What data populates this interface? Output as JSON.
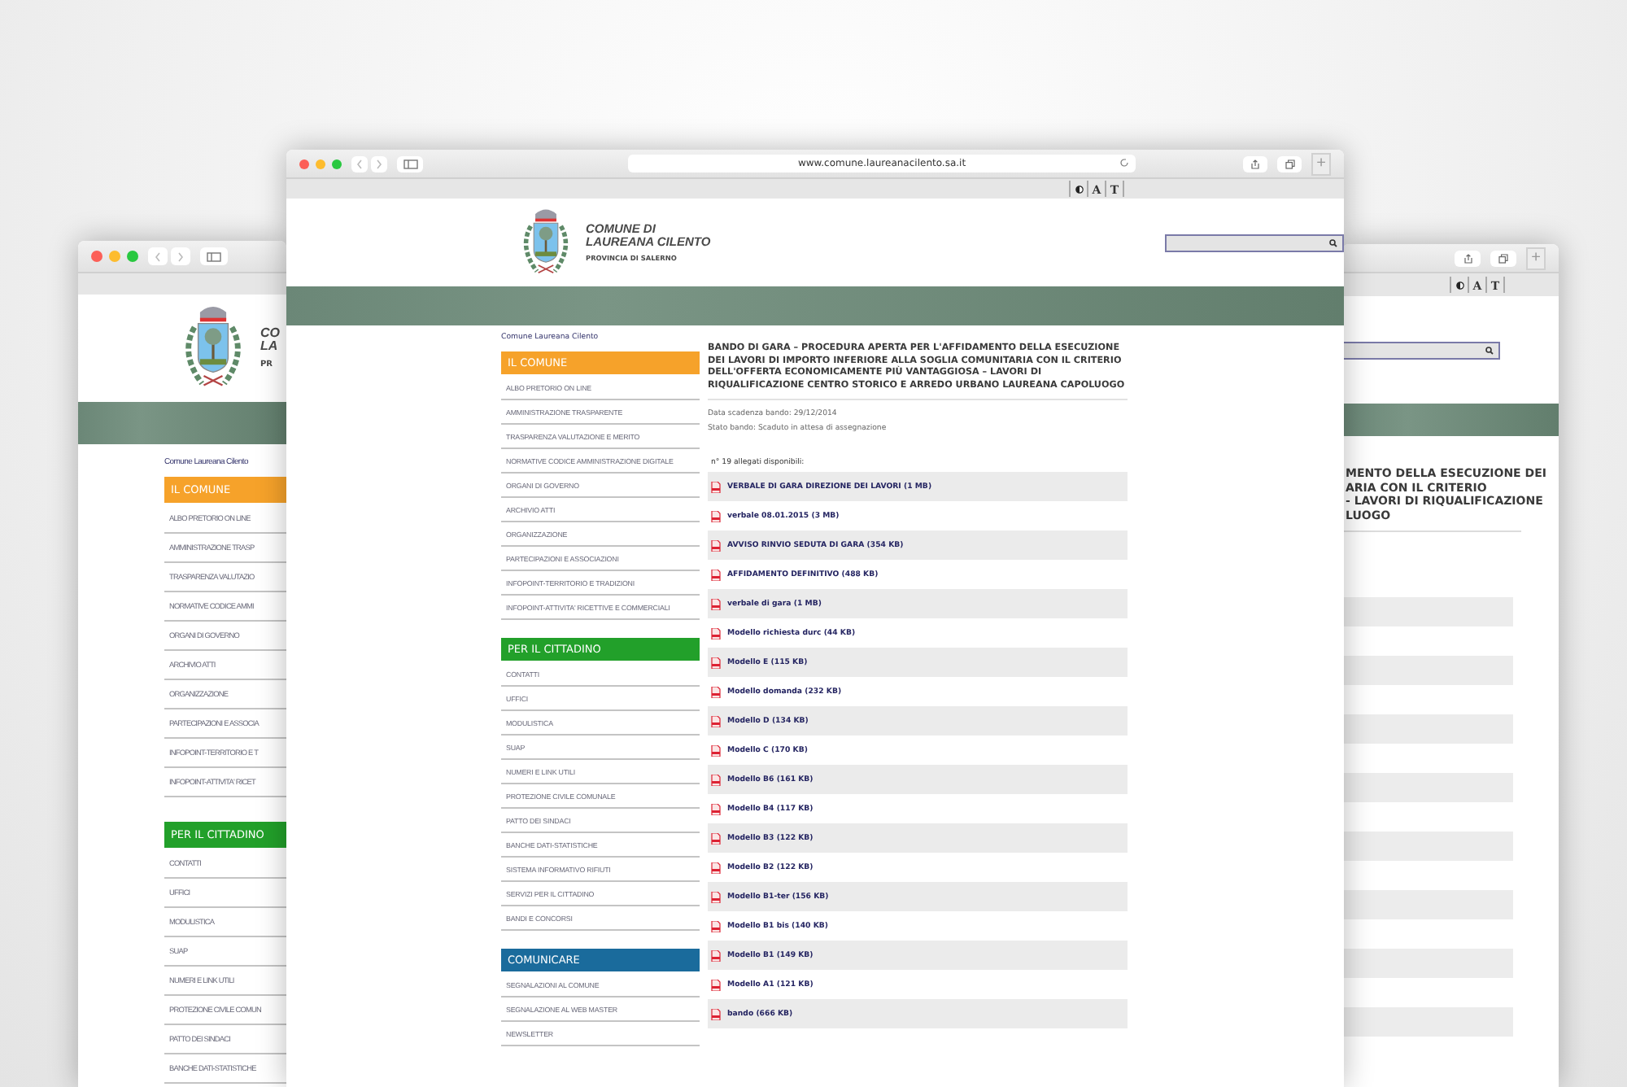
{
  "left_window": {
    "logo_text": [
      "CO",
      "LA",
      "PR"
    ],
    "breadcrumb": "Comune Laureana Cilento",
    "sections": [
      {
        "title": "IL COMUNE",
        "color": "#f6a22a",
        "items": [
          "ALBO PRETORIO ON LINE",
          "AMMINISTRAZIONE TRASP",
          "TRASPARENZA VALUTAZIO",
          "NORMATIVE CODICE AMMI",
          "ORGANI DI GOVERNO",
          "ARCHIVIO ATTI",
          "ORGANIZZAZIONE",
          "PARTECIPAZIONI E ASSOCIA",
          "INFOPOINT-TERRITORIO E T",
          "INFOPOINT-ATTIVITA' RICET"
        ]
      },
      {
        "title": "PER IL CITTADINO",
        "color": "#22a02a",
        "items": [
          "CONTATTI",
          "UFFICI",
          "MODULISTICA",
          "SUAP",
          "NUMERI E LINK UTILI",
          "PROTEZIONE CIVILE COMUN",
          "PATTO DEI SINDACI",
          "BANCHE DATI-STATISTICHE"
        ]
      }
    ]
  },
  "right_window": {
    "new_tab_label": "+",
    "font_buttons": [
      "A",
      "T"
    ],
    "title_lines": [
      "MENTO DELLA ESECUZIONE DEI",
      "ARIA CON IL CRITERIO",
      "- LAVORI DI RIQUALIFICAZIONE",
      "LUOGO"
    ]
  },
  "front_window": {
    "url": "www.comune.laureanacilento.sa.it",
    "new_tab_label": "+",
    "font_buttons": [
      "A",
      "T"
    ],
    "site": {
      "name_lines": [
        "COMUNE DI",
        "LAUREANA CILENTO"
      ],
      "province": "PROVINCIA DI SALERNO"
    },
    "breadcrumb": "Comune Laureana Cilento",
    "sections": [
      {
        "title": "IL COMUNE",
        "color": "#f6a22a",
        "items": [
          "ALBO PRETORIO ON LINE",
          "AMMINISTRAZIONE TRASPARENTE",
          "TRASPARENZA VALUTAZIONE E MERITO",
          "NORMATIVE CODICE AMMINISTRAZIONE DIGITALE",
          "ORGANI DI GOVERNO",
          "ARCHIVIO ATTI",
          "ORGANIZZAZIONE",
          "PARTECIPAZIONI E ASSOCIAZIONI",
          "INFOPOINT-TERRITORIO E TRADIZIONI",
          "INFOPOINT-ATTIVITA' RICETTIVE E COMMERCIALI"
        ]
      },
      {
        "title": "PER IL CITTADINO",
        "color": "#22a02a",
        "items": [
          "CONTATTI",
          "UFFICI",
          "MODULISTICA",
          "SUAP",
          "NUMERI E LINK UTILI",
          "PROTEZIONE CIVILE COMUNALE",
          "PATTO DEI SINDACI",
          "BANCHE DATI-STATISTICHE",
          "SISTEMA INFORMATIVO RIFIUTI",
          "SERVIZI PER IL CITTADINO",
          "BANDI E CONCORSI"
        ]
      },
      {
        "title": "COMUNICARE",
        "color": "#1a6b9c",
        "items": [
          "SEGNALAZIONI AL COMUNE",
          "SEGNALAZIONE AL WEB MASTER",
          "NEWSLETTER"
        ]
      }
    ],
    "article": {
      "title": "BANDO DI GARA – PROCEDURA APERTA PER L'AFFIDAMENTO DELLA ESECUZIONE DEI LAVORI DI IMPORTO INFERIORE ALLA SOGLIA COMUNITARIA CON IL CRITERIO DELL'OFFERTA ECONOMICAMENTE PIÙ VANTAGGIOSA – LAVORI DI RIQUALIFICAZIONE CENTRO STORICO E ARREDO URBANO LAUREANA CAPOLUOGO",
      "meta": [
        "Data scadenza bando: 29/12/2014",
        "Stato bando: Scaduto in attesa di assegnazione"
      ],
      "attachments_label": "n° 19 allegati disponibili:",
      "attachments": [
        "VERBALE DI GARA DIREZIONE DEI LAVORI (1 MB)",
        "verbale 08.01.2015 (3 MB)",
        "AVVISO RINVIO SEDUTA DI GARA (354 KB)",
        "AFFIDAMENTO DEFINITIVO (488 KB)",
        "verbale di gara (1 MB)",
        "Modello richiesta durc (44 KB)",
        "Modello E (115 KB)",
        "Modello domanda (232 KB)",
        "Modello D (134 KB)",
        "Modello C (170 KB)",
        "Modello B6 (161 KB)",
        "Modello B4 (117 KB)",
        "Modello B3 (122 KB)",
        "Modello B2 (122 KB)",
        "Modello B1-ter (156 KB)",
        "Modello B1 bis (140 KB)",
        "Modello B1 (149 KB)",
        "Modello A1 (121 KB)",
        "bando (666 KB)"
      ]
    }
  }
}
